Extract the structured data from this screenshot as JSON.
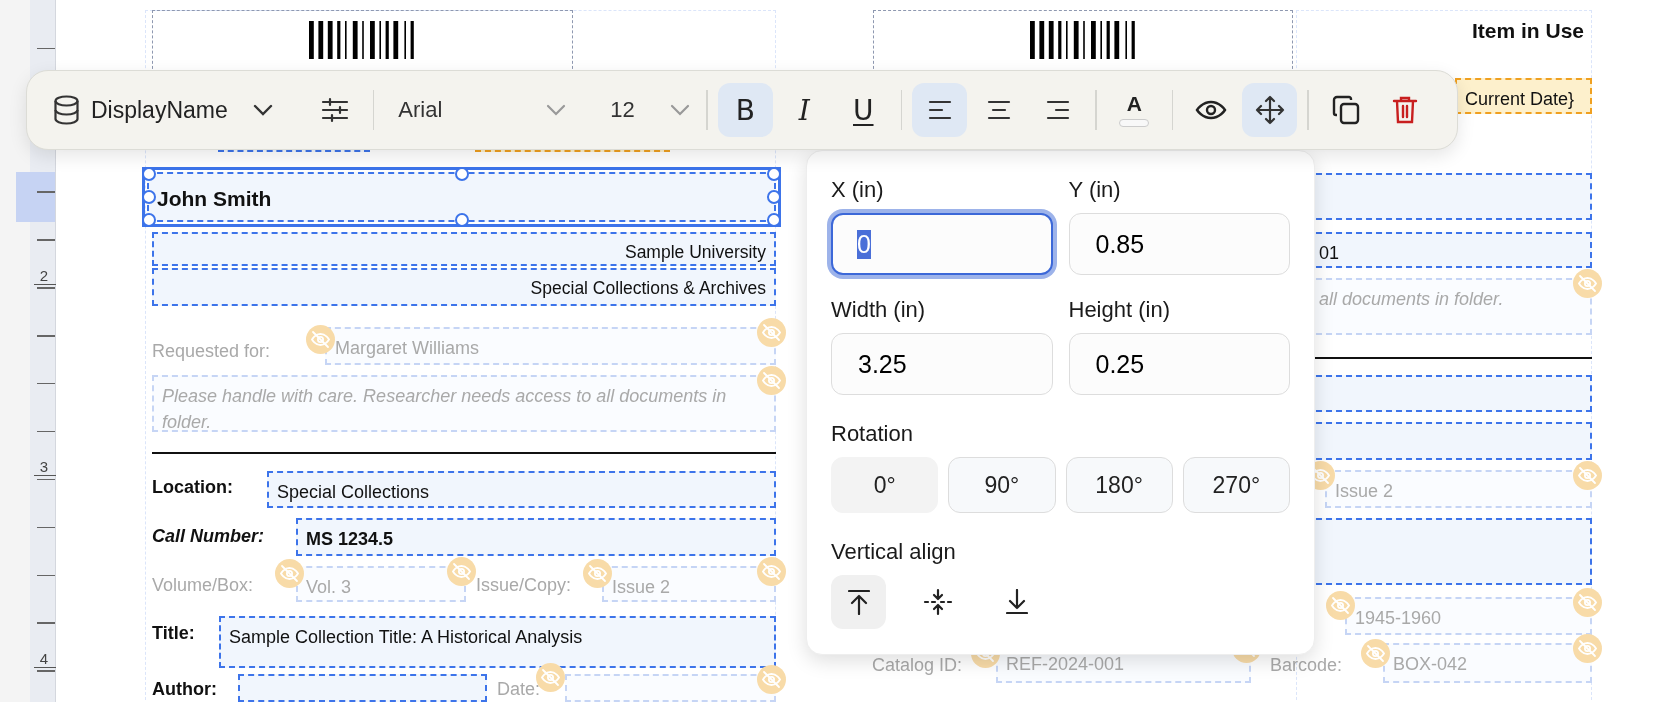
{
  "ruler": {
    "marks": [
      "2",
      "3",
      "4"
    ]
  },
  "canvas": {
    "elements": [
      {
        "kind": "barcode"
      },
      {
        "kind": "barcode"
      },
      {
        "kind": "text",
        "text": "Item in Use",
        "hidden": false,
        "selected": false
      },
      {
        "kind": "text",
        "text": "Current Date}",
        "hidden": false,
        "selected": false
      },
      {
        "kind": "text",
        "hidden": false,
        "selected": false
      },
      {
        "kind": "text",
        "hidden": false,
        "selected": false
      },
      {
        "kind": "text",
        "text": "John Smith",
        "hidden": false,
        "selected": true
      },
      {
        "kind": "text",
        "text": "Sample University",
        "hidden": false,
        "selected": false
      },
      {
        "kind": "text",
        "text": "Special Collections & Archives",
        "hidden": false,
        "selected": false
      },
      {
        "kind": "text",
        "text": "Requested for:",
        "hidden": true,
        "selected": false
      },
      {
        "kind": "text",
        "text": "Margaret Williams",
        "hidden": true,
        "selected": false
      },
      {
        "kind": "text",
        "text": "Please handle with care. Researcher needs access to all documents in folder.",
        "hidden": true,
        "selected": false
      },
      {
        "kind": "rule"
      },
      {
        "kind": "text",
        "text": "Location:",
        "hidden": false,
        "selected": false
      },
      {
        "kind": "text",
        "text": "Special Collections",
        "hidden": false,
        "selected": false
      },
      {
        "kind": "text",
        "text": "Call Number:",
        "hidden": false,
        "selected": false
      },
      {
        "kind": "text",
        "text": "MS 1234.5",
        "hidden": false,
        "selected": false
      },
      {
        "kind": "text",
        "text": "Volume/Box:",
        "hidden": true,
        "selected": false
      },
      {
        "kind": "text",
        "text": "Vol. 3",
        "hidden": true,
        "selected": false
      },
      {
        "kind": "text",
        "text": "Issue/Copy:",
        "hidden": true,
        "selected": false
      },
      {
        "kind": "text",
        "text": "Issue 2",
        "hidden": true,
        "selected": false
      },
      {
        "kind": "text",
        "text": "Title:",
        "hidden": false,
        "selected": false
      },
      {
        "kind": "text",
        "text": "Sample Collection Title: A Historical Analysis",
        "hidden": false,
        "selected": false
      },
      {
        "kind": "text",
        "text": "Author:",
        "hidden": false,
        "selected": false
      },
      {
        "kind": "text",
        "hidden": false,
        "selected": false
      },
      {
        "kind": "text",
        "text": "Date:",
        "hidden": true,
        "selected": false
      },
      {
        "kind": "text",
        "hidden": true,
        "selected": false
      },
      {
        "kind": "text",
        "hidden": false,
        "selected": false
      },
      {
        "kind": "text",
        "text": "01",
        "hidden": false,
        "selected": false
      },
      {
        "kind": "text",
        "text": "all documents in folder.",
        "hidden": true,
        "selected": false
      },
      {
        "kind": "rule"
      },
      {
        "kind": "text",
        "hidden": false,
        "selected": false
      },
      {
        "kind": "text",
        "hidden": false,
        "selected": false
      },
      {
        "kind": "text",
        "hidden": true,
        "selected": false
      },
      {
        "kind": "text",
        "text": "Issue 2",
        "hidden": true,
        "selected": false
      },
      {
        "kind": "text",
        "hidden": false,
        "selected": false
      },
      {
        "kind": "text",
        "hidden": true,
        "selected": false
      },
      {
        "kind": "text",
        "text": "1945-1960",
        "hidden": true,
        "selected": false
      },
      {
        "kind": "text",
        "text": "Catalog ID:",
        "hidden": true,
        "selected": false
      },
      {
        "kind": "text",
        "text": "REF-2024-001",
        "hidden": true,
        "selected": false
      },
      {
        "kind": "text",
        "text": "Barcode:",
        "hidden": true,
        "selected": false
      },
      {
        "kind": "text",
        "text": "BOX-042",
        "hidden": true,
        "selected": false
      }
    ]
  },
  "toolbar": {
    "data_field": "DisplayName",
    "font": "Arial",
    "font_size": "12",
    "groups": [
      [
        {
          "kind": "bold",
          "label": "B",
          "selected": true
        },
        {
          "kind": "italic",
          "label": "I",
          "selected": false
        },
        {
          "kind": "underline",
          "label": "U",
          "selected": false
        }
      ],
      [
        {
          "kind": "align-left",
          "selected": true
        },
        {
          "kind": "align-center",
          "selected": false
        },
        {
          "kind": "align-right",
          "selected": false
        }
      ],
      [
        {
          "kind": "text-color",
          "label": "A",
          "selected": false
        }
      ],
      [
        {
          "kind": "visibility",
          "selected": false
        },
        {
          "kind": "move",
          "selected": true
        }
      ],
      [
        {
          "kind": "duplicate",
          "selected": false
        },
        {
          "kind": "delete",
          "selected": false
        }
      ]
    ]
  },
  "position_panel": {
    "fields": [
      {
        "label": "X (in)",
        "value": "0",
        "focused": true
      },
      {
        "label": "Y (in)",
        "value": "0.85",
        "focused": false
      },
      {
        "label": "Width (in)",
        "value": "3.25",
        "focused": false
      },
      {
        "label": "Height (in)",
        "value": "0.25",
        "focused": false
      }
    ],
    "rotation_label": "Rotation",
    "rotations": [
      {
        "label": "0°",
        "selected": true
      },
      {
        "label": "90°",
        "selected": false
      },
      {
        "label": "180°",
        "selected": false
      },
      {
        "label": "270°",
        "selected": false
      }
    ],
    "valign_label": "Vertical align",
    "valign": [
      {
        "kind": "top",
        "selected": true
      },
      {
        "kind": "middle",
        "selected": false
      },
      {
        "kind": "bottom",
        "selected": false
      }
    ]
  }
}
